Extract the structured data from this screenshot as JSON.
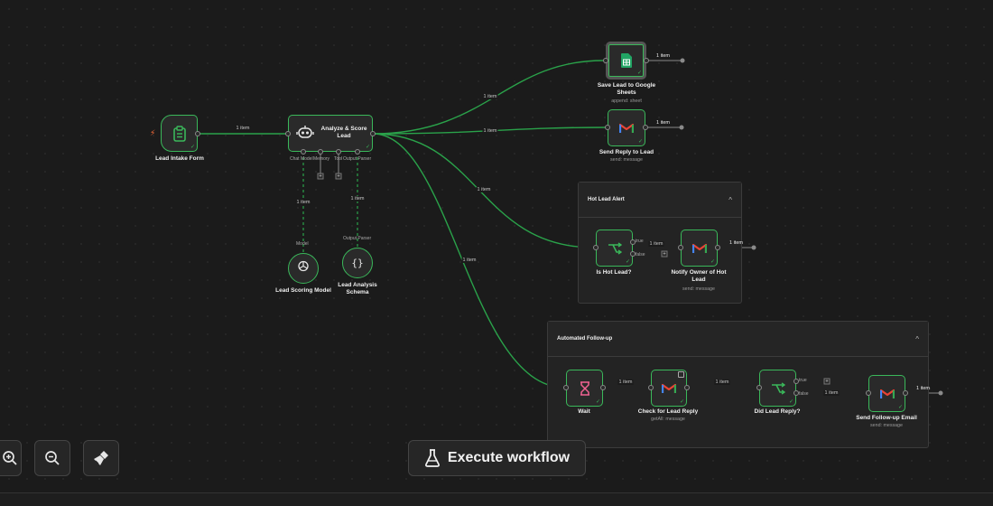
{
  "colors": {
    "accent": "#3ab85a",
    "edge": "#2aa24a",
    "background": "#1b1b1b",
    "trigger": "#ff6d3a",
    "gmail_red": "#ea4335",
    "sheets_green": "#21a464"
  },
  "groups": {
    "hot_lead_alert": {
      "title": "Hot Lead Alert",
      "chevron": "^"
    },
    "automated_follow_up": {
      "title": "Automated Follow-up",
      "chevron": "^"
    }
  },
  "nodes": {
    "lead_intake_form": {
      "label": "Lead Intake Form",
      "icon": "form-icon"
    },
    "analyze_score_lead": {
      "label_line1": "Analyze & Score",
      "label_line2": "Lead",
      "icon": "ai-agent-icon",
      "ports": {
        "chat_model": "Chat Model",
        "memory": "Memory",
        "tool": "Tool",
        "output_parser": "Output Parser"
      }
    },
    "lead_scoring_model": {
      "label": "Lead Scoring Model",
      "port": "Model",
      "icon": "openai-icon"
    },
    "lead_analysis_schema": {
      "label_line1": "Lead Analysis",
      "label_line2": "Schema",
      "port": "Output Parser",
      "icon": "code-braces-icon"
    },
    "save_lead_sheets": {
      "label_line1": "Save Lead to Google",
      "label_line2": "Sheets",
      "sub": "append: sheet",
      "icon": "google-sheets-icon"
    },
    "send_reply": {
      "label": "Send Reply to Lead",
      "sub": "send: message",
      "icon": "gmail-icon"
    },
    "is_hot_lead": {
      "label": "Is Hot Lead?",
      "true_label": "true",
      "false_label": "false",
      "icon": "if-branch-icon"
    },
    "notify_owner": {
      "label_line1": "Notify Owner of Hot",
      "label_line2": "Lead",
      "sub": "send: message",
      "icon": "gmail-icon"
    },
    "wait": {
      "label": "Wait",
      "icon": "hourglass-icon"
    },
    "check_reply": {
      "label": "Check for Lead Reply",
      "sub": "getAll: message",
      "icon": "gmail-icon"
    },
    "did_lead_reply": {
      "label": "Did Lead Reply?",
      "true_label": "true",
      "false_label": "false",
      "icon": "if-branch-icon"
    },
    "send_follow_up": {
      "label": "Send Follow-up Email",
      "sub": "send: message",
      "icon": "gmail-icon"
    }
  },
  "edge_labels": {
    "intake_to_analyze": "1 item",
    "analyze_to_sheets": "1 item",
    "analyze_to_reply": "1 item",
    "analyze_to_hot": "1 item",
    "analyze_to_wait": "1 item",
    "model_link": "1 item",
    "schema_link": "1 item",
    "hot_to_notify": "1 item",
    "wait_to_check": "1 item",
    "check_to_did": "1 item",
    "did_to_followup": "1 item",
    "sheets_out": "1 item",
    "reply_out": "1 item",
    "notify_out": "1 item",
    "followup_out": "1 item"
  },
  "toolbar": {
    "zoom_in": "zoom-in-icon",
    "zoom_out": "zoom-out-icon",
    "tidy": "broom-icon",
    "execute_label": "Execute workflow",
    "execute_icon": "flask-icon"
  }
}
